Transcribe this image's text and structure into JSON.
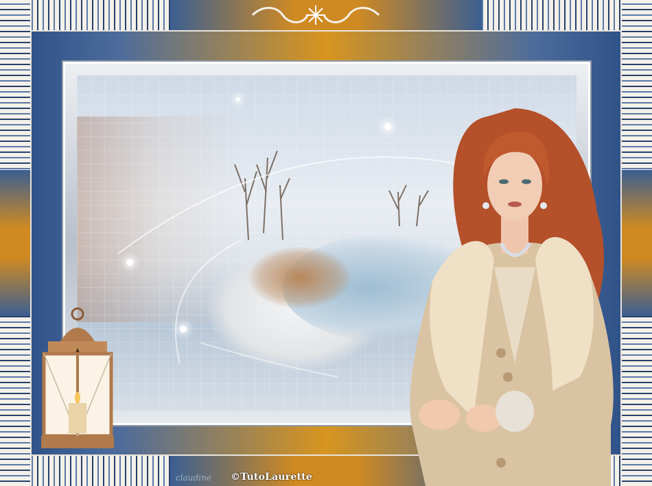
{
  "artwork": {
    "signature": "claudine",
    "credit": "©TutoLaurette"
  },
  "palette": {
    "navy": "#2b4f86",
    "gold": "#d8951f",
    "cream": "#f4f1ea",
    "hair": "#b4502a",
    "coat": "#d9c3a2",
    "fur": "#efe0c6"
  },
  "icons": [
    "ornament-flourish-icon",
    "snowflake-icon",
    "lantern-icon",
    "candle-icon"
  ]
}
